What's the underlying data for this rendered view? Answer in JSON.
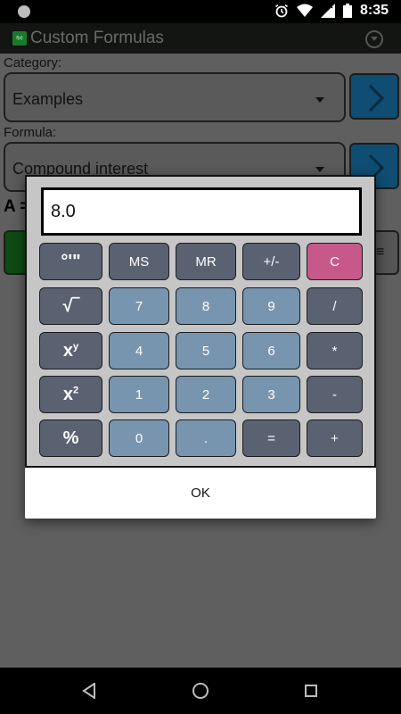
{
  "status_bar": {
    "time": "8:35",
    "icons": [
      "alarm-icon",
      "wifi-icon",
      "signal-icon",
      "battery-icon"
    ]
  },
  "app_bar": {
    "logo_text": "f(x)",
    "title": "Custom Formulas"
  },
  "form": {
    "category_label": "Category:",
    "category_value": "Examples",
    "formula_label": "Formula:",
    "formula_value": "Compound interest",
    "result_prefix": "A =",
    "right_button_glyph": "≡"
  },
  "calculator": {
    "display_value": "8.0",
    "keys": {
      "deg_min_sec": "°'\"",
      "memory_store": "MS",
      "memory_recall": "MR",
      "negate": "+/-",
      "clear": "C",
      "sqrt": "√‾",
      "power_base": "x",
      "power_exp": "y",
      "square_base": "x",
      "square_exp": "2",
      "percent": "%",
      "seven": "7",
      "eight": "8",
      "nine": "9",
      "divide": "/",
      "four": "4",
      "five": "5",
      "six": "6",
      "multiply": "*",
      "one": "1",
      "two": "2",
      "three": "3",
      "minus": "-",
      "zero": "0",
      "decimal": ".",
      "equals": "=",
      "plus": "+"
    },
    "ok_label": "OK"
  },
  "colors": {
    "fn_key": "#5a6272",
    "digit_key": "#7895b0",
    "clear_key": "#c7598a",
    "next_button": "#0f4d72",
    "green_button": "#0e4a14"
  }
}
